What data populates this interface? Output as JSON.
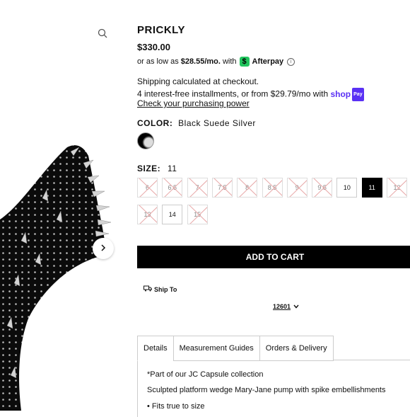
{
  "product": {
    "title": "PRICKLY",
    "price": "$330.00"
  },
  "afterpay": {
    "prefix": "or as low as",
    "amount": "$28.55/mo.",
    "with": "with",
    "brand": "Afterpay"
  },
  "shipping": {
    "line1": "Shipping calculated at checkout.",
    "line2": "4 interest-free installments, or from $29.79/mo with",
    "shop_brand": "shop",
    "shop_pay": "Pay",
    "power_link": "Check your purchasing power"
  },
  "color": {
    "label": "COLOR:",
    "value": "Black Suede Silver"
  },
  "size": {
    "label": "SIZE:",
    "value": "11",
    "options": [
      {
        "label": "6",
        "state": "na"
      },
      {
        "label": "6.5",
        "state": "na"
      },
      {
        "label": "7",
        "state": "na"
      },
      {
        "label": "7.5",
        "state": "na"
      },
      {
        "label": "8",
        "state": "na"
      },
      {
        "label": "8.5",
        "state": "na"
      },
      {
        "label": "9",
        "state": "na"
      },
      {
        "label": "9.5",
        "state": "na"
      },
      {
        "label": "10",
        "state": "avail"
      },
      {
        "label": "11",
        "state": "sel"
      },
      {
        "label": "12",
        "state": "na"
      },
      {
        "label": "13",
        "state": "na"
      },
      {
        "label": "14",
        "state": "avail"
      },
      {
        "label": "15",
        "state": "na"
      }
    ]
  },
  "cart": {
    "add_label": "ADD TO CART"
  },
  "delivery": {
    "ship_to": "Ship To",
    "zip": "12601"
  },
  "tabs": [
    {
      "label": "Details"
    },
    {
      "label": "Measurement Guides"
    },
    {
      "label": "Orders & Delivery"
    }
  ],
  "details": {
    "line1": "*Part of our JC Capsule collection",
    "line2": "Sculpted platform wedge Mary-Jane pump with spike embellishments",
    "bullet1": "Fits true to size"
  },
  "colors": {
    "accent_green": "#22c55e",
    "shop_pay_purple": "#5a31f4",
    "cart_button": "#000000"
  }
}
